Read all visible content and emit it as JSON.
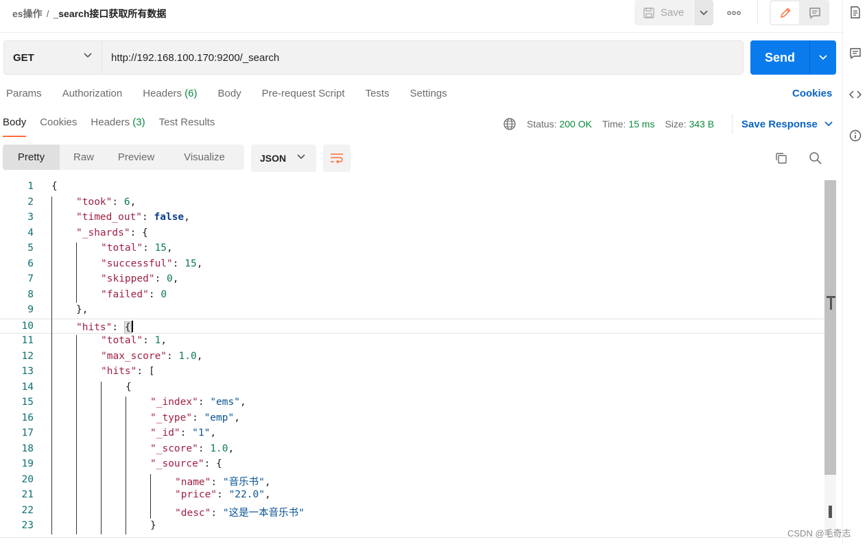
{
  "header": {
    "collection": "es操作",
    "separator": "/",
    "request_name": "_search接口获取所有数据",
    "save_label": "Save"
  },
  "request": {
    "method": "GET",
    "url": "http://192.168.100.170:9200/_search",
    "send_label": "Send"
  },
  "request_tabs": [
    {
      "label": "Params",
      "count": ""
    },
    {
      "label": "Authorization",
      "count": ""
    },
    {
      "label": "Headers",
      "count": "(6)"
    },
    {
      "label": "Body",
      "count": ""
    },
    {
      "label": "Pre-request Script",
      "count": ""
    },
    {
      "label": "Tests",
      "count": ""
    },
    {
      "label": "Settings",
      "count": ""
    }
  ],
  "cookies_link": "Cookies",
  "response_tabs": [
    {
      "label": "Body",
      "count": ""
    },
    {
      "label": "Cookies",
      "count": ""
    },
    {
      "label": "Headers",
      "count": "(3)"
    },
    {
      "label": "Test Results",
      "count": ""
    }
  ],
  "response_status": {
    "status_label": "Status:",
    "status_value": "200 OK",
    "time_label": "Time:",
    "time_value": "15 ms",
    "size_label": "Size:",
    "size_value": "343 B",
    "save_response": "Save Response"
  },
  "view_modes": [
    "Pretty",
    "Raw",
    "Preview",
    "Visualize"
  ],
  "language": "JSON",
  "code_lines": [
    {
      "n": "1",
      "indent": 0,
      "tokens": [
        [
          "p",
          "{"
        ]
      ]
    },
    {
      "n": "2",
      "indent": 1,
      "tokens": [
        [
          "k",
          "\"took\""
        ],
        [
          "p",
          ": "
        ],
        [
          "n",
          "6"
        ],
        [
          "p",
          ","
        ]
      ]
    },
    {
      "n": "3",
      "indent": 1,
      "tokens": [
        [
          "k",
          "\"timed_out\""
        ],
        [
          "p",
          ": "
        ],
        [
          "b",
          "false"
        ],
        [
          "p",
          ","
        ]
      ]
    },
    {
      "n": "4",
      "indent": 1,
      "tokens": [
        [
          "k",
          "\"_shards\""
        ],
        [
          "p",
          ": {"
        ]
      ]
    },
    {
      "n": "5",
      "indent": 2,
      "tokens": [
        [
          "k",
          "\"total\""
        ],
        [
          "p",
          ": "
        ],
        [
          "n",
          "15"
        ],
        [
          "p",
          ","
        ]
      ]
    },
    {
      "n": "6",
      "indent": 2,
      "tokens": [
        [
          "k",
          "\"successful\""
        ],
        [
          "p",
          ": "
        ],
        [
          "n",
          "15"
        ],
        [
          "p",
          ","
        ]
      ]
    },
    {
      "n": "7",
      "indent": 2,
      "tokens": [
        [
          "k",
          "\"skipped\""
        ],
        [
          "p",
          ": "
        ],
        [
          "n",
          "0"
        ],
        [
          "p",
          ","
        ]
      ]
    },
    {
      "n": "8",
      "indent": 2,
      "tokens": [
        [
          "k",
          "\"failed\""
        ],
        [
          "p",
          ": "
        ],
        [
          "n",
          "0"
        ]
      ]
    },
    {
      "n": "9",
      "indent": 1,
      "tokens": [
        [
          "p",
          "},"
        ]
      ]
    },
    {
      "n": "10",
      "indent": 1,
      "tokens": [
        [
          "k",
          "\"hits\""
        ],
        [
          "p",
          ": "
        ],
        [
          "hl",
          "{"
        ]
      ]
    },
    {
      "n": "11",
      "indent": 2,
      "tokens": [
        [
          "k",
          "\"total\""
        ],
        [
          "p",
          ": "
        ],
        [
          "n",
          "1"
        ],
        [
          "p",
          ","
        ]
      ]
    },
    {
      "n": "12",
      "indent": 2,
      "tokens": [
        [
          "k",
          "\"max_score\""
        ],
        [
          "p",
          ": "
        ],
        [
          "n",
          "1.0"
        ],
        [
          "p",
          ","
        ]
      ]
    },
    {
      "n": "13",
      "indent": 2,
      "tokens": [
        [
          "k",
          "\"hits\""
        ],
        [
          "p",
          ": ["
        ]
      ]
    },
    {
      "n": "14",
      "indent": 3,
      "tokens": [
        [
          "p",
          "{"
        ]
      ]
    },
    {
      "n": "15",
      "indent": 4,
      "tokens": [
        [
          "k",
          "\"_index\""
        ],
        [
          "p",
          ": "
        ],
        [
          "s",
          "\"ems\""
        ],
        [
          "p",
          ","
        ]
      ]
    },
    {
      "n": "16",
      "indent": 4,
      "tokens": [
        [
          "k",
          "\"_type\""
        ],
        [
          "p",
          ": "
        ],
        [
          "s",
          "\"emp\""
        ],
        [
          "p",
          ","
        ]
      ]
    },
    {
      "n": "17",
      "indent": 4,
      "tokens": [
        [
          "k",
          "\"_id\""
        ],
        [
          "p",
          ": "
        ],
        [
          "s",
          "\"1\""
        ],
        [
          "p",
          ","
        ]
      ]
    },
    {
      "n": "18",
      "indent": 4,
      "tokens": [
        [
          "k",
          "\"_score\""
        ],
        [
          "p",
          ": "
        ],
        [
          "n",
          "1.0"
        ],
        [
          "p",
          ","
        ]
      ]
    },
    {
      "n": "19",
      "indent": 4,
      "tokens": [
        [
          "k",
          "\"_source\""
        ],
        [
          "p",
          ": {"
        ]
      ]
    },
    {
      "n": "20",
      "indent": 5,
      "tokens": [
        [
          "k",
          "\"name\""
        ],
        [
          "p",
          ": "
        ],
        [
          "s",
          "\"音乐书\""
        ],
        [
          "p",
          ","
        ]
      ]
    },
    {
      "n": "21",
      "indent": 5,
      "tokens": [
        [
          "k",
          "\"price\""
        ],
        [
          "p",
          ": "
        ],
        [
          "s",
          "\"22.0\""
        ],
        [
          "p",
          ","
        ]
      ]
    },
    {
      "n": "22",
      "indent": 5,
      "tokens": [
        [
          "k",
          "\"desc\""
        ],
        [
          "p",
          ": "
        ],
        [
          "s",
          "\"这是一本音乐书\""
        ]
      ]
    },
    {
      "n": "23",
      "indent": 4,
      "tokens": [
        [
          "p",
          "}"
        ]
      ]
    }
  ],
  "current_line": "10",
  "watermark": "CSDN @毛奇志",
  "colors": {
    "accent_orange": "#ff6c37",
    "send_blue": "#097bed",
    "link_blue": "#0a64c2",
    "status_green": "#0b8a3f"
  },
  "icons": [
    "save-icon",
    "chevron-down-icon",
    "more-icon",
    "pencil-icon",
    "comment-icon",
    "documentation-icon",
    "comments-icon",
    "code-icon",
    "info-icon",
    "globe-icon",
    "wrap-lines-icon",
    "copy-icon",
    "search-icon"
  ]
}
